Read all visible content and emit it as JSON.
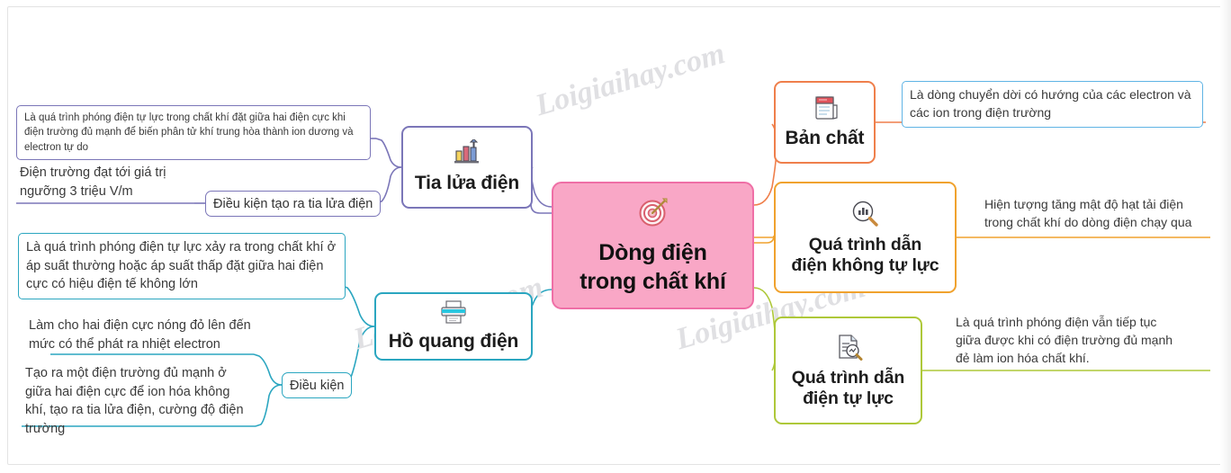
{
  "watermarks": [
    {
      "text": "Loigiaihay.com"
    },
    {
      "text": "Loigiaihay.com"
    },
    {
      "text": "Loigiaihay.com"
    }
  ],
  "colors": {
    "center_fill": "#f9a7c6",
    "center_border": "#ef6fa6",
    "purple": "#7b76b8",
    "cyan": "#2ba6c0",
    "orange": "#ef7f4b",
    "amber": "#f0a22e",
    "olive": "#aec839",
    "light_blue": "#5fb4e5",
    "text_body": "#3a3a3a",
    "text_heading": "#1c1c1c"
  },
  "center": {
    "title_line1": "Dòng điện",
    "title_line2": "trong chất khí",
    "icon": "target-icon"
  },
  "branches": {
    "tia_lua_dien": {
      "label": "Tia lửa điện",
      "icon": "bar-chart-icon",
      "color": "#7b76b8",
      "definition": "Là quá trình phóng điện tự lực trong chất khí đặt giữa hai điện cực khi điện trường đủ mạnh để biến phân tử khí trung hòa thành ion dương và electron tự do",
      "condition_label": "Điều kiện tạo ra tia lửa điện",
      "condition_text_line1": "Điện trường đạt tới giá trị",
      "condition_text_line2": "ngưỡng 3 triệu V/m"
    },
    "ho_quang_dien": {
      "label": "Hồ quang điện",
      "icon": "printer-icon",
      "color": "#2ba6c0",
      "definition": "Là quá trình phóng điện tự lực xảy ra trong chất khí ở áp suất thường hoặc áp suất thấp đặt giữa hai điện cực có hiệu điện tế không lớn",
      "condition_label": "Điều kiện",
      "condition_items": [
        "Làm cho hai điện cực nóng đỏ lên đến mức có thể phát ra nhiệt electron",
        "Tạo ra một điện trường đủ mạnh ở giữa hai điện cực để ion hóa không khí, tạo ra tia lửa điện, cường độ điện trường"
      ]
    },
    "ban_chat": {
      "label": "Bản chất",
      "icon": "notepad-icon",
      "color": "#ef7f4b",
      "detail": "Là dòng chuyển dời có hướng của các electron và các ion trong điện trường",
      "detail_border": "#5fb4e5"
    },
    "dan_dien_khong_tu_luc": {
      "label_line1": "Quá trình dẫn",
      "label_line2": "điện không tự lực",
      "icon": "chart-magnifier-icon",
      "color": "#f0a22e",
      "detail_line1": "Hiện tượng tăng mật độ hạt tải điện",
      "detail_line2": "trong  chất khí do dòng điện chạy qua"
    },
    "dan_dien_tu_luc": {
      "label_line1": "Quá trình dẫn",
      "label_line2": "điện tự lực",
      "icon": "document-magnifier-icon",
      "color": "#aec839",
      "detail_line1": "Là quá trình phóng điện vẫn tiếp tục",
      "detail_line2": "giữa được khi có điện trường đủ mạnh",
      "detail_line3": "đẻ làm ion hóa chất khí."
    }
  }
}
